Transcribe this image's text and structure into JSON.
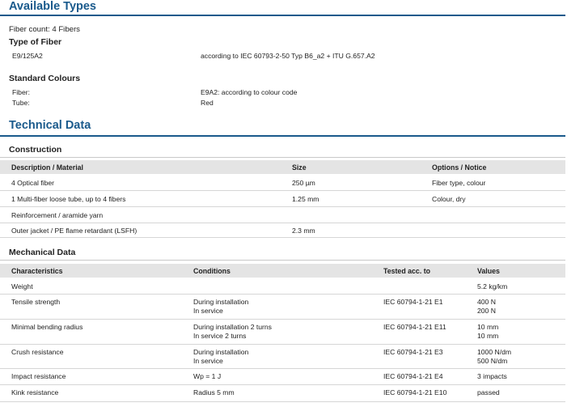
{
  "available_types": {
    "title": "Available Types",
    "fiber_count": "Fiber count: 4 Fibers",
    "type_of_fiber": {
      "heading": "Type of Fiber",
      "name": "E9/125A2",
      "value": "according to IEC 60793-2-50 Typ B6_a2 + ITU G.657.A2"
    },
    "standard_colours": {
      "heading": "Standard Colours",
      "fiber_label": "Fiber:",
      "fiber_value": "E9A2: according to colour code",
      "tube_label": "Tube:",
      "tube_value": "Red"
    }
  },
  "technical_data": {
    "title": "Technical Data",
    "construction": {
      "heading": "Construction",
      "headers": [
        "Description / Material",
        "Size",
        "Options / Notice"
      ],
      "rows": [
        [
          "4 Optical fiber",
          "250 µm",
          "Fiber type, colour"
        ],
        [
          "1 Multi-fiber loose tube, up to 4 fibers",
          "1.25 mm",
          "Colour, dry"
        ],
        [
          "Reinforcement / aramide yarn",
          "",
          ""
        ],
        [
          "Outer jacket / PE flame retardant (LSFH)",
          "2.3 mm",
          ""
        ]
      ]
    },
    "mechanical": {
      "heading": "Mechanical Data",
      "headers": [
        "Characteristics",
        "Conditions",
        "Tested acc. to",
        "Values"
      ],
      "rows": [
        {
          "characteristic": "Weight",
          "conditions": [
            "",
            ""
          ],
          "tested": "",
          "values": [
            "5.2 kg/km",
            ""
          ]
        },
        {
          "characteristic": "Tensile strength",
          "conditions": [
            "During installation",
            "In service"
          ],
          "tested": "IEC 60794-1-21 E1",
          "values": [
            "400 N",
            "200 N"
          ]
        },
        {
          "characteristic": "Minimal bending radius",
          "conditions": [
            "During installation 2 turns",
            "In service 2 turns"
          ],
          "tested": "IEC 60794-1-21 E11",
          "values": [
            "10 mm",
            "10 mm"
          ]
        },
        {
          "characteristic": "Crush resistance",
          "conditions": [
            "During installation",
            "In service"
          ],
          "tested": "IEC 60794-1-21 E3",
          "values": [
            "1000 N/dm",
            "500 N/dm"
          ]
        },
        {
          "characteristic": "Impact resistance",
          "conditions": [
            "Wp = 1 J",
            ""
          ],
          "tested": "IEC 60794-1-21 E4",
          "values": [
            "3 impacts",
            ""
          ]
        },
        {
          "characteristic": "Kink resistance",
          "conditions": [
            "Radius 5 mm",
            ""
          ],
          "tested": "IEC 60794-1-21 E10",
          "values": [
            "passed",
            ""
          ]
        }
      ]
    }
  }
}
